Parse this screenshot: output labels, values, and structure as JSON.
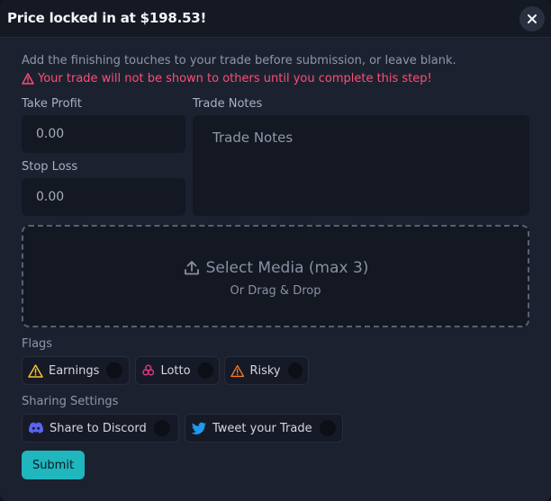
{
  "header": {
    "title": "Price locked in at $198.53!",
    "close_icon": "close-icon"
  },
  "intro": {
    "description": "Add the finishing touches to your trade before submission, or leave blank.",
    "warning": "Your trade will not be shown to others until you complete this step!",
    "warning_color": "#ff4d73"
  },
  "fields": {
    "take_profit_label": "Take Profit",
    "take_profit_value": "0.00",
    "stop_loss_label": "Stop Loss",
    "stop_loss_value": "0.00",
    "notes_label": "Trade Notes",
    "notes_placeholder": "Trade Notes"
  },
  "media": {
    "title": "Select Media (max 3)",
    "subtitle": "Or Drag & Drop",
    "icon": "upload-icon"
  },
  "flags": {
    "label": "Flags",
    "items": [
      {
        "label": "Earnings",
        "icon": "warning-icon",
        "color": "#f2c230"
      },
      {
        "label": "Lotto",
        "icon": "biohazard-icon",
        "color": "#e23a8a"
      },
      {
        "label": "Risky",
        "icon": "warning-icon",
        "color": "#f07a2a"
      }
    ]
  },
  "sharing": {
    "label": "Sharing Settings",
    "items": [
      {
        "label": "Share to Discord",
        "icon": "discord-icon",
        "color": "#5865f2"
      },
      {
        "label": "Tweet your Trade",
        "icon": "twitter-icon",
        "color": "#1d9bf0"
      }
    ]
  },
  "submit_label": "Submit",
  "accent_color": "#1fb6bd"
}
